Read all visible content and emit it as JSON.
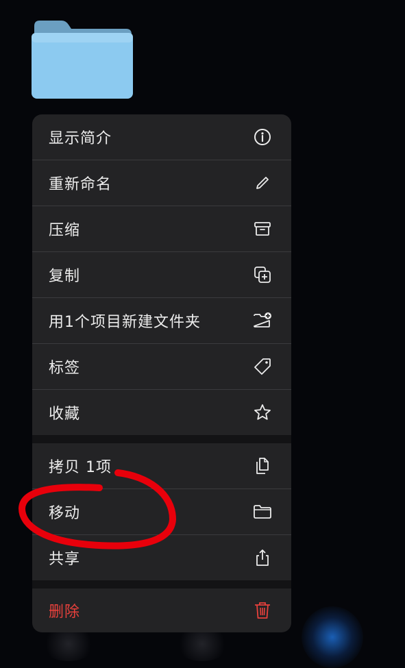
{
  "menu": {
    "items": [
      {
        "label": "显示简介",
        "icon": "info-icon"
      },
      {
        "label": "重新命名",
        "icon": "pencil-icon"
      },
      {
        "label": "压缩",
        "icon": "archive-box-icon"
      },
      {
        "label": "复制",
        "icon": "duplicate-plus-icon"
      },
      {
        "label": "用1个项目新建文件夹",
        "icon": "folder-plus-icon"
      },
      {
        "label": "标签",
        "icon": "tag-icon"
      },
      {
        "label": "收藏",
        "icon": "star-icon"
      },
      {
        "label": "拷贝 1项",
        "icon": "copy-docs-icon"
      },
      {
        "label": "移动",
        "icon": "folder-icon"
      },
      {
        "label": "共享",
        "icon": "share-icon"
      },
      {
        "label": "删除",
        "icon": "trash-icon"
      }
    ]
  },
  "colors": {
    "background": "#05060a",
    "menu_background": "#232325",
    "text": "#ececec",
    "destructive": "#e8413c",
    "folder_blue": "#8ccaf0",
    "annotation_red": "#e8000b"
  }
}
